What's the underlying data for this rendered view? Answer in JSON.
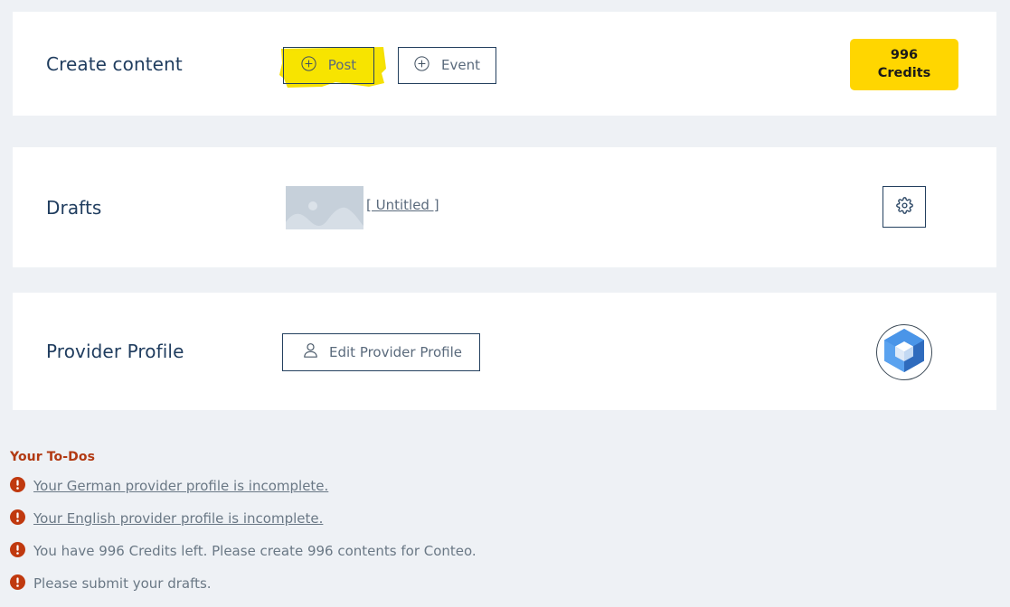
{
  "theme": {
    "page_background": "#eef1f5",
    "card_background": "#ffffff",
    "accent_yellow": "#ffd600",
    "highlight_marker": "#f5e005",
    "title_navy": "#1f3c5e",
    "body_grey": "#6a7885",
    "todo_heading_red": "#b23a13",
    "alert_icon_red": "#c0390f",
    "thumb_grey": "#c6d0da",
    "logo_blue_light": "#4a95e8",
    "logo_blue_mid": "#3b7fd4",
    "logo_blue_dark": "#2f6bbd"
  },
  "create_content": {
    "title": "Create content",
    "post_button": {
      "label": "Post",
      "icon": "plus-circle-icon",
      "highlighted": true
    },
    "event_button": {
      "label": "Event",
      "icon": "plus-circle-icon"
    },
    "credits": {
      "amount": "996",
      "unit": "Credits"
    }
  },
  "drafts": {
    "title": "Drafts",
    "items": [
      {
        "thumbnail": "image-placeholder-icon",
        "title": "[ Untitled ]"
      }
    ],
    "settings_button": {
      "icon": "gear-icon"
    }
  },
  "provider_profile": {
    "title": "Provider Profile",
    "edit_button": {
      "label": "Edit Provider Profile",
      "icon": "person-icon"
    },
    "avatar": {
      "icon": "cube-logo-icon"
    }
  },
  "todos": {
    "heading": "Your To-Dos",
    "items": [
      {
        "icon": "alert-circle-icon",
        "text": "Your German provider profile is incomplete.",
        "is_link": true
      },
      {
        "icon": "alert-circle-icon",
        "text": "Your English provider profile is incomplete.",
        "is_link": true
      },
      {
        "icon": "alert-circle-icon",
        "text": "You have 996 Credits left. Please create 996 contents for Conteo.",
        "is_link": false
      },
      {
        "icon": "alert-circle-icon",
        "text": "Please submit your drafts.",
        "is_link": false
      }
    ]
  }
}
